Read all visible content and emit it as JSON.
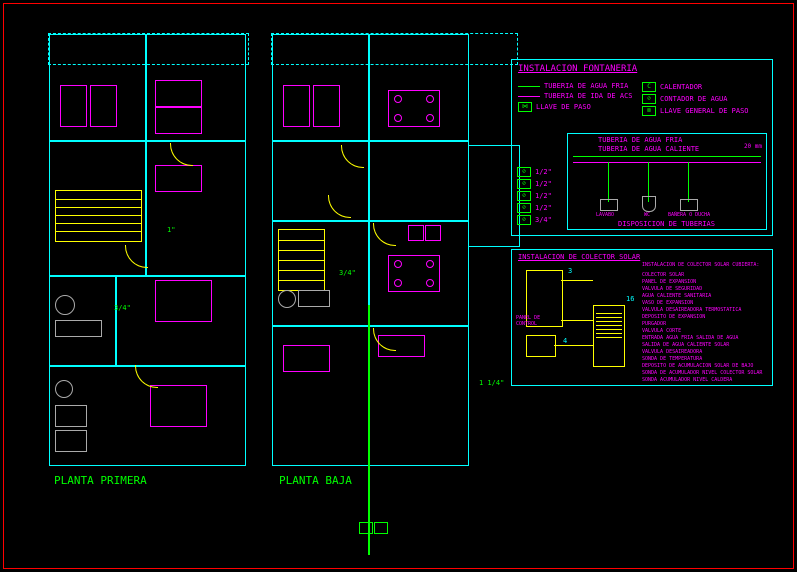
{
  "plans": {
    "first": {
      "label": "PLANTA PRIMERA"
    },
    "ground": {
      "label": "PLANTA BAJA"
    }
  },
  "dims": {
    "d1": "1\"",
    "d2": "3/4\"",
    "d3": "3/4\"",
    "d4": "1 1/4\""
  },
  "legend1": {
    "title": "INSTALACION FONTANERIA",
    "rows": {
      "l1": "TUBERIA DE AGUA FRIA",
      "l2": "TUBERIA DE IDA DE ACS",
      "l3": "LLAVE DE PASO",
      "r1": "CALENTADOR",
      "r2": "CONTADOR DE AGUA",
      "r3": "LLAVE GENERAL DE PASO"
    },
    "pipes": {
      "title1": "TUBERIA DE AGUA FRIA",
      "title2": "TUBERIA DE AGUA CALIENTE",
      "s1": "1/2\"",
      "s2": "1/2\"",
      "s3": "1/2\"",
      "s4": "1/2\"",
      "s5": "3/4\"",
      "lbl_lav": "LAVABO",
      "lbl_wc": "WC",
      "lbl_bid": "BAÑERA O DUCHA",
      "caption": "DISPOSICION DE TUBERIAS",
      "diam": "20 mm"
    }
  },
  "legend2": {
    "title": "INSTALACION DE COLECTOR SOLAR",
    "subtitle": "INSTALACION DE COLECTOR SOLAR CUBIERTA:",
    "panel": "PANEL DE CONTROL",
    "items": {
      "i1": "COLECTOR SOLAR",
      "i2": "PANEL DE EXPANSION",
      "i3": "VALVULA DE SEGURIDAD",
      "i4": "AGUA CALIENTE SANITARIA",
      "i5": "VASO DE EXPANSION",
      "i6": "VALVULA DESAIREADORA TERMOSTATICA",
      "i7": "DEPOSITO DE EXPANSION",
      "i8": "PURGADOR",
      "i9": "VALVULA CORTE",
      "i10": "ENTRADA AGUA FRIA SALIDA DE AGUA",
      "i11": "SALIDA DE AGUA CALIENTE SOLAR",
      "i12": "VALVULA DESAIREADORA",
      "i13": "SONDA DE TEMPERATURA",
      "i14": "DEPOSITO DE ACUMULACION SOLAR DE BAJO",
      "i15": "SONDA DE ACUMULADOR NIVEL COLECTOR SOLAR",
      "i16": "SONDA ACUMULADOR NIVEL CALDERA"
    },
    "nums": {
      "n3": "3",
      "n4": "4",
      "n16": "16"
    }
  }
}
